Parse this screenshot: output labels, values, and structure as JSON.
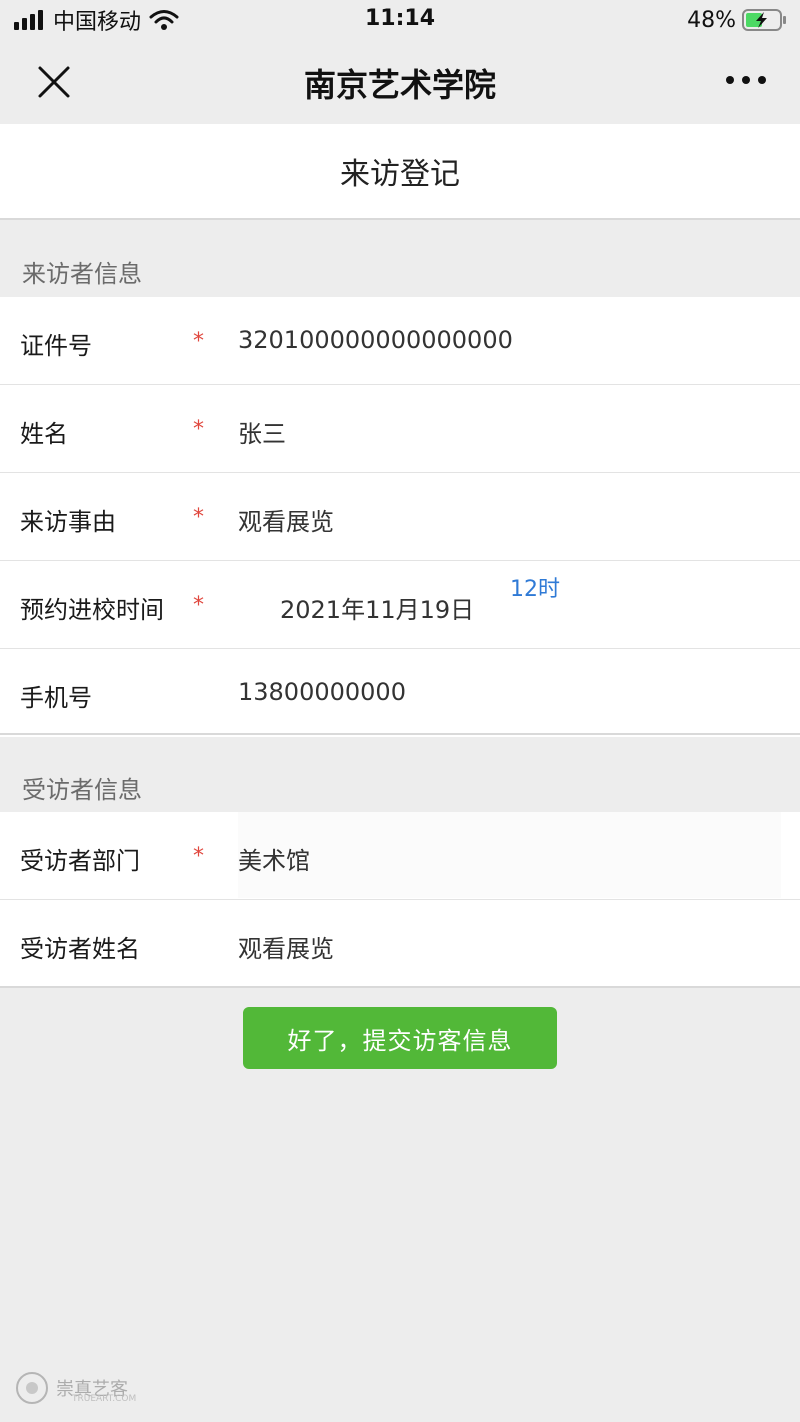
{
  "status_bar": {
    "carrier": "中国移动",
    "time": "11:14",
    "battery": "48%"
  },
  "nav": {
    "title": "南京艺术学院"
  },
  "page": {
    "title": "来访登记"
  },
  "visitor_section": {
    "title": "来访者信息",
    "rows": [
      {
        "label": "证件号",
        "required": "*",
        "value": "320100000000000000"
      },
      {
        "label": "姓名",
        "required": "*",
        "value": "张三"
      },
      {
        "label": "来访事由",
        "required": "*",
        "value": "观看展览"
      },
      {
        "label": "预约进校时间",
        "required": "*",
        "value": "2021年11月19日",
        "hour": "12时"
      },
      {
        "label": "手机号",
        "required": "",
        "value": "13800000000"
      }
    ]
  },
  "host_section": {
    "title": "受访者信息",
    "rows": [
      {
        "label": "受访者部门",
        "required": "*",
        "value": "美术馆"
      },
      {
        "label": "受访者姓名",
        "required": "",
        "value": "观看展览"
      }
    ]
  },
  "submit": {
    "label": "好了，提交访客信息",
    "color": "#52b838"
  },
  "colors": {
    "required_star": "#e0473e",
    "link": "#2f7ad6",
    "background": "#ededed"
  },
  "watermark": {
    "text": "崇真艺客",
    "sub": "TRUEART.COM"
  }
}
